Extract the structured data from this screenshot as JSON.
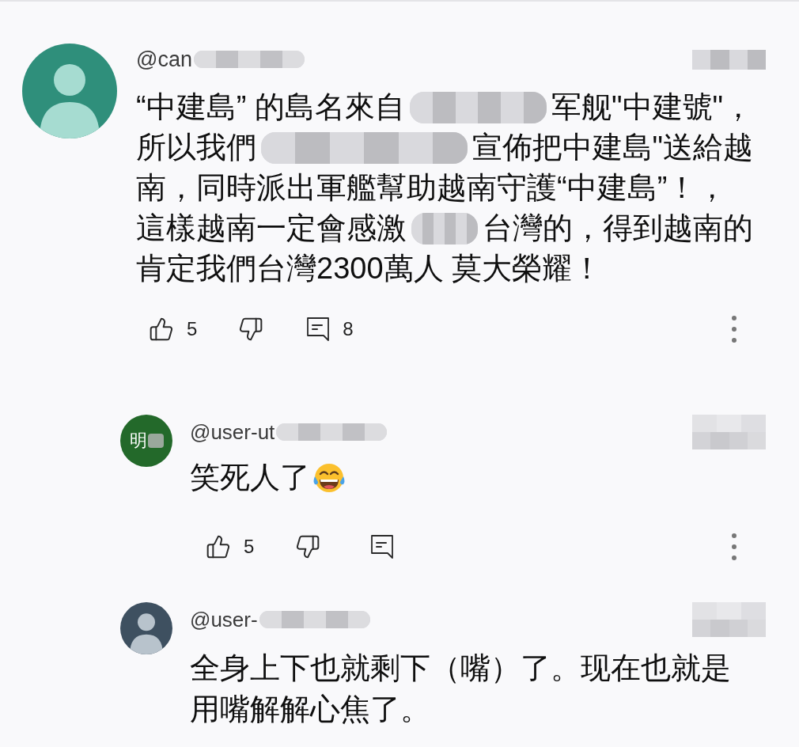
{
  "comment": {
    "author": "@can",
    "author_redacted": true,
    "time_redacted": true,
    "avatar": {
      "kind": "silhouette",
      "color": "#2f8f7b"
    },
    "lines": [
      [
        {
          "kind": "text",
          "text": "“中建島” 的島名來自"
        },
        {
          "kind": "redacted"
        },
        {
          "kind": "text",
          "text": "军舰\"中建號\"，"
        }
      ],
      [
        {
          "kind": "text",
          "text": "所以我們"
        },
        {
          "kind": "redacted"
        },
        {
          "kind": "text",
          "text": "宣佈把中建島\"送給越"
        }
      ],
      [
        {
          "kind": "text",
          "text": "南，同時派出軍艦幫助越南守護“中建島”！，"
        }
      ],
      [
        {
          "kind": "text",
          "text": "這樣越南一定會感激"
        },
        {
          "kind": "redacted"
        },
        {
          "kind": "text",
          "text": "台灣的，得到越南的"
        }
      ],
      [
        {
          "kind": "text",
          "text": "肯定我們台灣2300萬人 莫大榮耀！"
        }
      ]
    ],
    "actions": {
      "likes": "5",
      "replies": "8"
    },
    "replies": [
      {
        "author": "@user-ut",
        "author_redacted": true,
        "time_redacted": true,
        "avatar": {
          "kind": "initial",
          "label": "明",
          "label_redacted": true,
          "color": "#23692a"
        },
        "lines": [
          [
            {
              "kind": "text",
              "text": "笑死人了"
            },
            {
              "kind": "emoji"
            }
          ]
        ],
        "actions": {
          "likes": "5"
        }
      },
      {
        "author": "@user-",
        "author_redacted": true,
        "time_redacted": true,
        "avatar": {
          "kind": "silhouette",
          "color": "#3e5060"
        },
        "lines": [
          [
            {
              "kind": "text",
              "text": "全身上下也就剩下（嘴）了。现在也就是"
            }
          ],
          [
            {
              "kind": "text",
              "text": "用嘴解解心焦了。"
            }
          ]
        ]
      }
    ]
  }
}
